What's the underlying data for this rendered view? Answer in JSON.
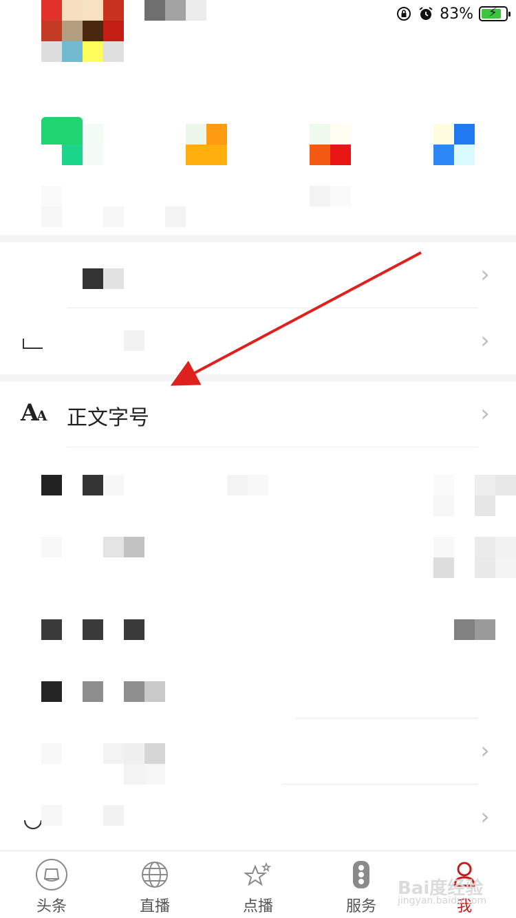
{
  "status_bar": {
    "battery_percent": "83%",
    "battery_level": 0.83,
    "icons": [
      "orientation-lock-icon",
      "alarm-icon",
      "battery-charging-icon"
    ]
  },
  "settings": {
    "font_size_label": "正文字号",
    "font_icon_big": "A",
    "font_icon_small": "A"
  },
  "tabbar": {
    "tabs": [
      {
        "label": "头条",
        "icon": "headlines-icon"
      },
      {
        "label": "直播",
        "icon": "globe-icon"
      },
      {
        "label": "点播",
        "icon": "stars-icon"
      },
      {
        "label": "服务",
        "icon": "traffic-light-icon"
      },
      {
        "label": "我",
        "icon": "profile-icon"
      }
    ],
    "active_index": 4
  },
  "watermark": {
    "text": "Bai度经验",
    "sub": "jingyan.baidu.com"
  },
  "colors": {
    "accent": "#c81b1b",
    "annotation_arrow": "#e0201c",
    "chevron": "#bdbdbd"
  }
}
